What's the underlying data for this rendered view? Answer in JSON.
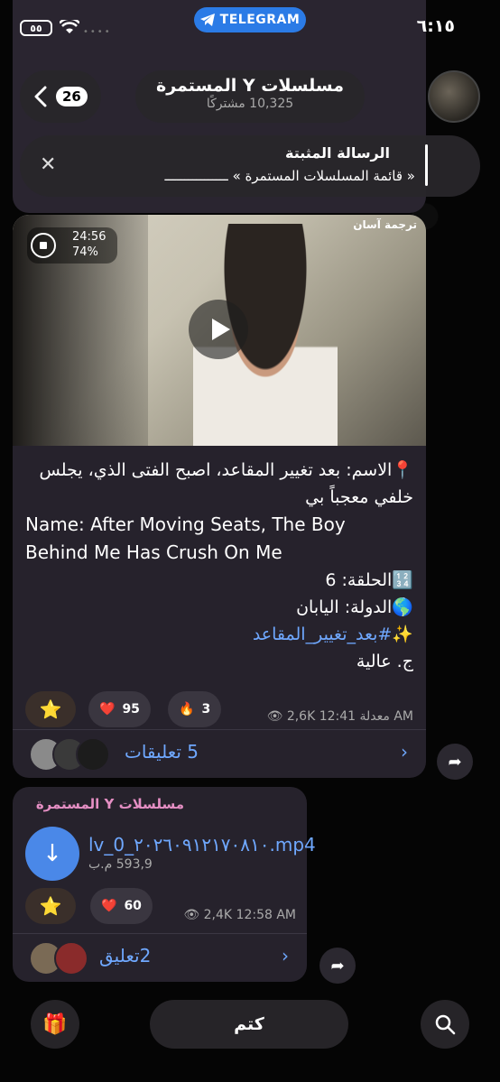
{
  "status": {
    "time": "٦:١٥",
    "app_pill": "TELEGRAM",
    "battery": "٥٥"
  },
  "header": {
    "back_count": "26",
    "title": "مسلسلات Y المستمرة",
    "subscribers": "10,325 مشتركًا"
  },
  "pinned": {
    "title": "الرسالة المثبتة",
    "text": "« قائمة المسلسلات المستمرة » ــــــــــــــــ"
  },
  "post": {
    "video_tag": "ترجمة آسان",
    "duration": "24:56",
    "progress": "74%",
    "line1": "📍الاسم: بعد تغيير المقاعد، اصبح الفتى الذي، يجلس خلفي معجباً بي",
    "name_en": "Name: After Moving Seats, The Boy Behind Me Has Crush On Me",
    "episode": "🔢الحلقة: 6",
    "country": "🌎الدولة: اليابان",
    "hashtag": "✨#بعد_تغيير_المقاعد",
    "quality": "ج. عالية",
    "reactions": [
      {
        "icon": "⭐",
        "count": ""
      },
      {
        "icon": "❤️",
        "count": "95"
      },
      {
        "icon": "🔥",
        "count": "3"
      }
    ],
    "meta": "👁 2,6K 12:41 معدلة AM",
    "comments": "5 تعليقات"
  },
  "file_post": {
    "sender": "مسلسلات Y المستمرة",
    "file_name": "lv_0_٢٠٢٦٠٩١٢١٧٠٨١٠.mp4",
    "file_size": "593,9 م.ب",
    "reactions": [
      {
        "icon": "⭐",
        "count": ""
      },
      {
        "icon": "❤️",
        "count": "60"
      }
    ],
    "meta": "👁 2,4K 12:58 AM",
    "comments": "2تعليق"
  },
  "bottom": {
    "mute": "كتم"
  },
  "colors": {
    "accent": "#6fa8ff",
    "telegram_pill": "#2b7be6",
    "bubble": "#26222c",
    "sender": "#e58fc4"
  }
}
